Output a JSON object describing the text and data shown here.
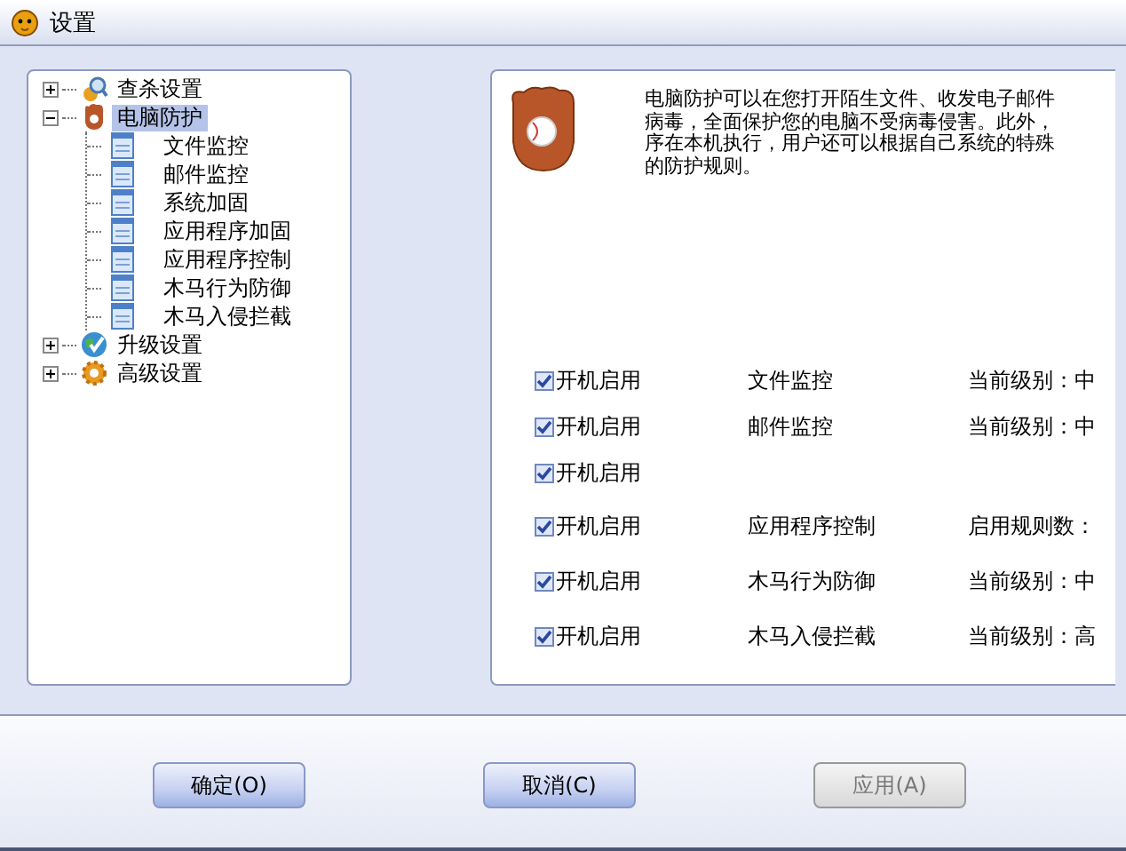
{
  "window": {
    "title": "设置"
  },
  "tree": [
    {
      "label": "查杀设置",
      "expanded": false,
      "selected": false
    },
    {
      "label": "电脑防护",
      "expanded": true,
      "selected": true,
      "children": [
        {
          "label": "文件监控",
          "selected": false
        },
        {
          "label": "邮件监控",
          "selected": false
        },
        {
          "label": "系统加固",
          "selected": false
        },
        {
          "label": "应用程序加固",
          "selected": false
        },
        {
          "label": "应用程序控制",
          "selected": false
        },
        {
          "label": "木马行为防御",
          "selected": false
        },
        {
          "label": "木马入侵拦截",
          "selected": false
        }
      ]
    },
    {
      "label": "升级设置",
      "expanded": false,
      "selected": false
    },
    {
      "label": "高级设置",
      "expanded": false,
      "selected": false
    }
  ],
  "description": [
    "电脑防护可以在您打开陌生文件、收发电子邮件",
    "病毒，全面保护您的电脑不受病毒侵害。此外，",
    "序在本机执行，用户还可以根据自己系统的特殊",
    "的防护规则。"
  ],
  "monitors": [
    {
      "label": "开机启用",
      "checked": true,
      "name": "文件监控",
      "status": "当前级别：中"
    },
    {
      "label": "开机启用",
      "checked": true,
      "name": "邮件监控",
      "status": "当前级别：中"
    },
    {
      "label": "开机启用",
      "checked": true
    },
    {
      "label": "开机启用",
      "checked": true,
      "name": "应用程序控制",
      "status": "启用规则数："
    },
    {
      "label": "开机启用",
      "checked": true,
      "name": "木马行为防御",
      "status": "当前级别：中"
    },
    {
      "label": "开机启用",
      "checked": true,
      "name": "木马入侵拦截",
      "status": "当前级别：高"
    }
  ],
  "buttons": [
    {
      "label": "确定(O)",
      "disabled": false
    },
    {
      "label": "取消(C)",
      "disabled": false
    },
    {
      "label": "应用(A)",
      "disabled": true
    }
  ]
}
